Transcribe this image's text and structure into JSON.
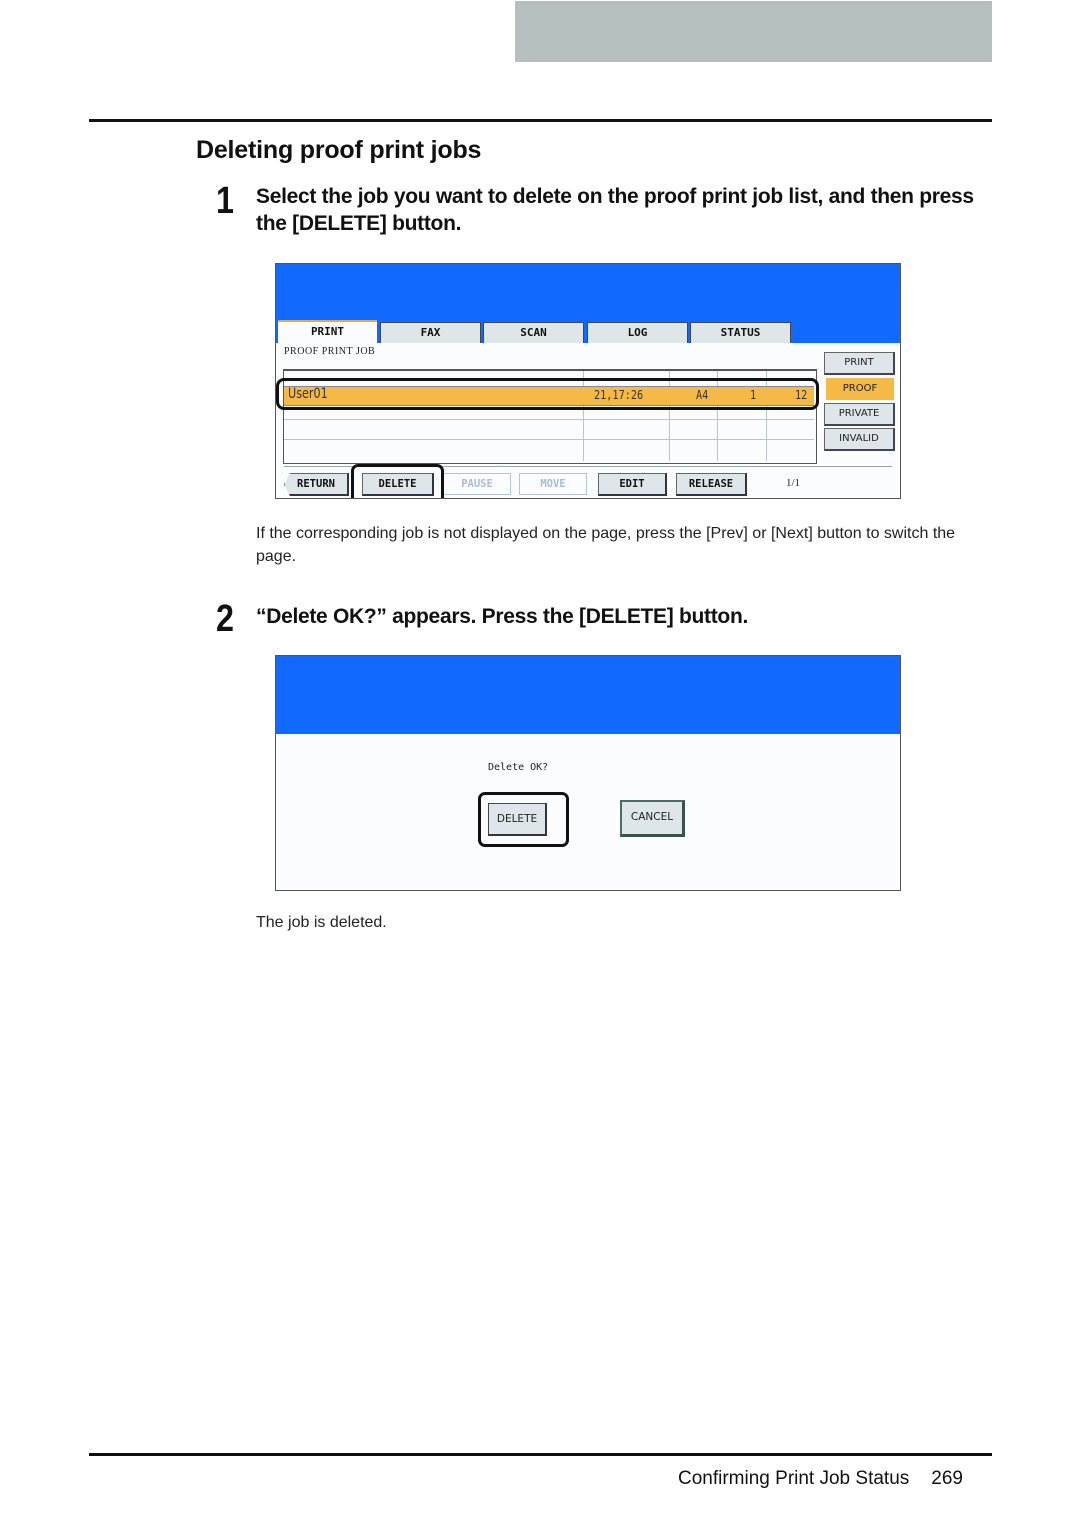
{
  "page": {
    "section_title": "Deleting proof print jobs",
    "steps": [
      {
        "number": "1",
        "text": "Select the job you want to delete on the proof print job list, and then press the [DELETE] button."
      },
      {
        "number": "2",
        "text": "“Delete OK?” appears. Press the [DELETE] button."
      }
    ],
    "note_step1": "If the corresponding job is not displayed on the page, press the [Prev] or [Next] button to switch the page.",
    "note_step2": "The job is deleted.",
    "footer": {
      "title": "Confirming Print Job Status",
      "page_number": "269"
    }
  },
  "screen1": {
    "tabs": [
      {
        "label": "PRINT",
        "active": true
      },
      {
        "label": "FAX",
        "active": false
      },
      {
        "label": "SCAN",
        "active": false
      },
      {
        "label": "LOG",
        "active": false
      },
      {
        "label": "STATUS",
        "active": false
      }
    ],
    "list_label": "PROOF PRINT JOB",
    "jobs": [
      {
        "user": "User01",
        "date_time": "21,17:26",
        "paper": "A4",
        "sets": "1",
        "pages": "12",
        "selected": true
      }
    ],
    "side_buttons": [
      {
        "label": "PRINT",
        "active": false
      },
      {
        "label": "PROOF",
        "active": true
      },
      {
        "label": "PRIVATE",
        "active": false
      },
      {
        "label": "INVALID",
        "active": false
      }
    ],
    "bottom_buttons": [
      {
        "label": "RETURN",
        "enabled": true
      },
      {
        "label": "DELETE",
        "enabled": true
      },
      {
        "label": "PAUSE",
        "enabled": false
      },
      {
        "label": "MOVE",
        "enabled": false
      },
      {
        "label": "EDIT",
        "enabled": true
      },
      {
        "label": "RELEASE",
        "enabled": true
      }
    ],
    "page_indicator": "1/1"
  },
  "screen2": {
    "message": "Delete OK?",
    "delete_label": "DELETE",
    "cancel_label": "CANCEL"
  },
  "colors": {
    "screen_blue": "#1269fd",
    "selected_orange": "#f5b946",
    "header_gray": "#b5bfbf"
  }
}
